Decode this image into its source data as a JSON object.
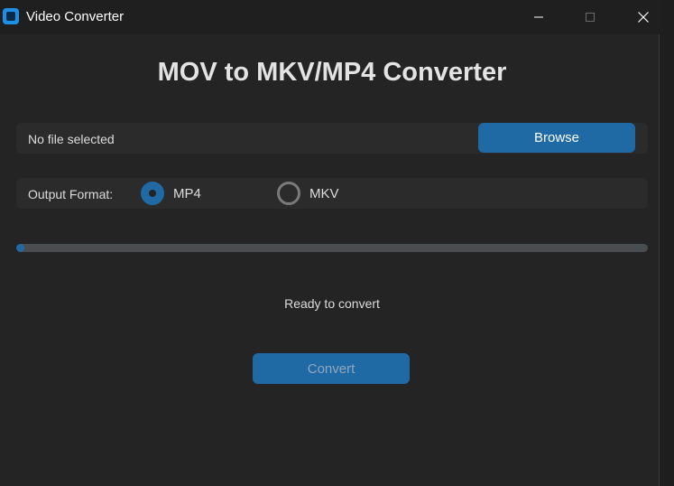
{
  "window": {
    "title": "Video Converter"
  },
  "main": {
    "heading": "MOV to MKV/MP4 Converter",
    "file_label": "No file selected",
    "browse_label": "Browse",
    "output_format_label": "Output Format:",
    "formats": [
      {
        "label": "MP4",
        "selected": true
      },
      {
        "label": "MKV",
        "selected": false
      }
    ],
    "progress": 0.01,
    "status": "Ready to convert",
    "convert_label": "Convert"
  },
  "colors": {
    "accent": "#1f6aa5",
    "background": "#242424",
    "panel": "#2b2b2b",
    "progress_track": "#4a4d50",
    "app_icon": "#1e8fe6"
  },
  "icons": {
    "app": "video-converter-app-icon",
    "minimize": "minimize-icon",
    "maximize": "maximize-icon",
    "close": "close-icon"
  }
}
